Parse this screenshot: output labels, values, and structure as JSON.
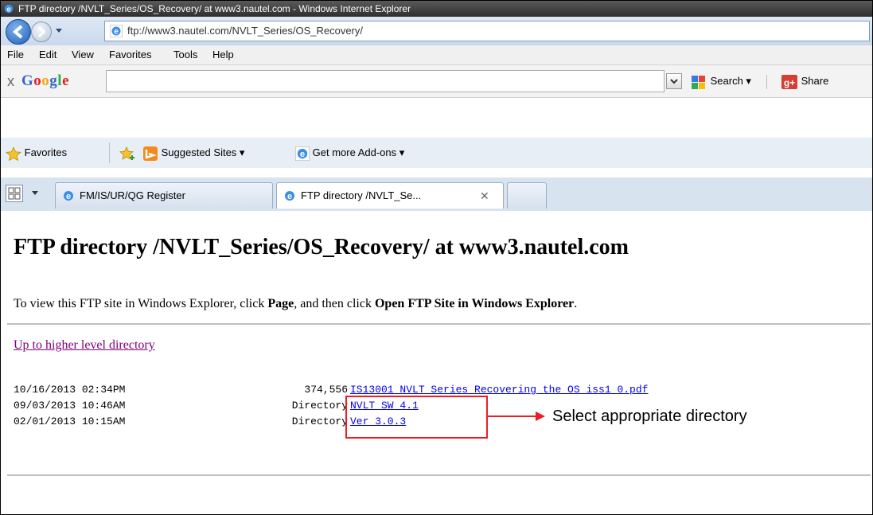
{
  "window": {
    "title": "FTP directory /NVLT_Series/OS_Recovery/ at www3.nautel.com - Windows Internet Explorer"
  },
  "address_bar": {
    "url": "ftp://www3.nautel.com/NVLT_Series/OS_Recovery/"
  },
  "menu": {
    "items": [
      "File",
      "Edit",
      "View",
      "Favorites",
      "Tools",
      "Help"
    ]
  },
  "google_toolbar": {
    "close": "x",
    "logo": "Google",
    "search_value": "",
    "search_label": "Search ▾",
    "share_label": "Share"
  },
  "favorites_bar": {
    "favorites_label": "Favorites",
    "suggested_sites_label": "Suggested Sites ▾",
    "get_addons_label": "Get more Add-ons ▾"
  },
  "tabs": [
    {
      "label": "FM/IS/UR/QG Register"
    },
    {
      "label": "FTP directory /NVLT_Se...",
      "close": "✕"
    }
  ],
  "page": {
    "heading": "FTP directory /NVLT_Series/OS_Recovery/ at www3.nautel.com",
    "info_prefix": "To view this FTP site in Windows Explorer, click ",
    "info_page": "Page",
    "info_middle": ", and then click ",
    "info_open": "Open FTP Site in Windows Explorer",
    "info_suffix": ".",
    "up_link": "Up to higher level directory",
    "entries": [
      {
        "date": "10/16/2013 02:34PM",
        "size": "374,556",
        "name": "IS13001_NVLT_Series_Recovering_the_OS_iss1_0.pdf"
      },
      {
        "date": "09/03/2013 10:46AM",
        "size": "Directory",
        "name": "NVLT_SW_4.1"
      },
      {
        "date": "02/01/2013 10:15AM",
        "size": "Directory",
        "name": "Ver_3.0.3"
      }
    ]
  },
  "annotation": {
    "callout": "Select appropriate directory",
    "color": "#ee1c24"
  }
}
